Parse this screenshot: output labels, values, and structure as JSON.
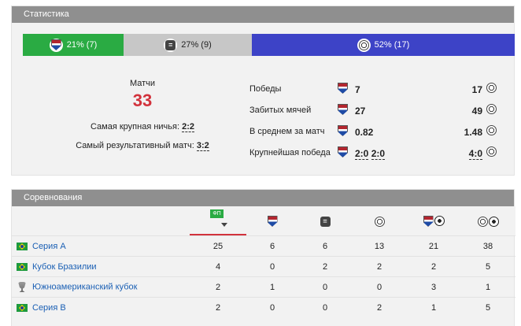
{
  "stats": {
    "title": "Статистика",
    "bar": {
      "home_pct": "21% (7)",
      "draw_pct": "27% (9)",
      "away_pct": "52% (17)"
    },
    "matches_label": "Матчи",
    "matches_count": "33",
    "biggest_draw_label": "Самая крупная ничья:",
    "biggest_draw_value": "2:2",
    "highest_scoring_label": "Самый результативный матч:",
    "highest_scoring_value": "3:2",
    "rows": [
      {
        "label": "Победы",
        "home": "7",
        "away": "17"
      },
      {
        "label": "Забитых мячей",
        "home": "27",
        "away": "49"
      },
      {
        "label": "В среднем за матч",
        "home": "0.82",
        "away": "1.48"
      },
      {
        "label": "Крупнейшая победа",
        "home_a": "2:0",
        "home_b": "2:0",
        "away": "4:0"
      }
    ]
  },
  "competitions": {
    "title": "Соревнования",
    "header_field_label": "ФП",
    "rows": [
      {
        "name": "Серия А",
        "icon": "brazil-flag-icon",
        "c1": "25",
        "c2": "6",
        "c3": "6",
        "c4": "13",
        "c5": "21",
        "c6": "38"
      },
      {
        "name": "Кубок Бразилии",
        "icon": "brazil-flag-icon",
        "c1": "4",
        "c2": "0",
        "c3": "2",
        "c4": "2",
        "c5": "2",
        "c6": "5"
      },
      {
        "name": "Южноамериканский кубок",
        "icon": "trophy-icon",
        "c1": "2",
        "c2": "1",
        "c3": "0",
        "c4": "0",
        "c5": "3",
        "c6": "1"
      },
      {
        "name": "Серия В",
        "icon": "brazil-flag-icon",
        "c1": "2",
        "c2": "0",
        "c3": "0",
        "c4": "2",
        "c5": "1",
        "c6": "5"
      }
    ]
  },
  "colors": {
    "home": "#2aab43",
    "draw": "#c7c7c7",
    "away": "#3d43c7",
    "accent": "#d2323c",
    "link": "#1a5fb4"
  }
}
